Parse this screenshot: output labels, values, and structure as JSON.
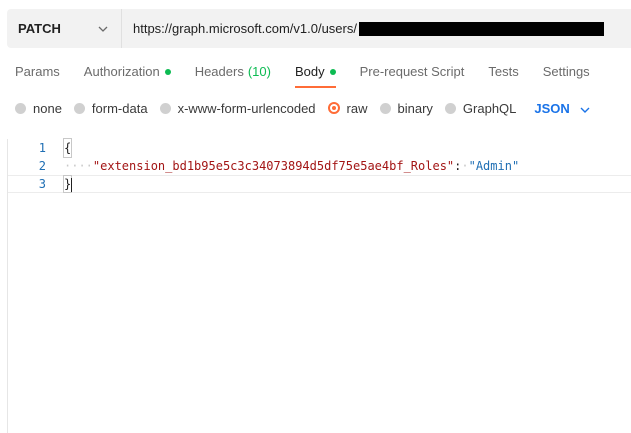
{
  "request": {
    "method": "PATCH",
    "url": "https://graph.microsoft.com/v1.0/users/"
  },
  "tabs": [
    {
      "label": "Params"
    },
    {
      "label": "Authorization",
      "indicator": "green-dot"
    },
    {
      "label": "Headers",
      "count": "(10)"
    },
    {
      "label": "Body",
      "indicator": "green-dot",
      "active": true
    },
    {
      "label": "Pre-request Script"
    },
    {
      "label": "Tests"
    },
    {
      "label": "Settings"
    }
  ],
  "body_types": {
    "options": [
      "none",
      "form-data",
      "x-www-form-urlencoded",
      "raw",
      "binary",
      "GraphQL"
    ],
    "selected": "raw",
    "language": "JSON"
  },
  "editor": {
    "line_numbers": [
      "1",
      "2",
      "3"
    ],
    "open_brace": "{",
    "indent": "····",
    "key": "\"extension_bd1b95e5c3c34073894d5df75e5ae4bf_Roles\"",
    "colon": ":",
    "value": "\"Admin\"",
    "close_brace": "}"
  },
  "colors": {
    "accent": "#ff6c37",
    "indicator": "#0cbb52",
    "link": "#1a73e8"
  }
}
